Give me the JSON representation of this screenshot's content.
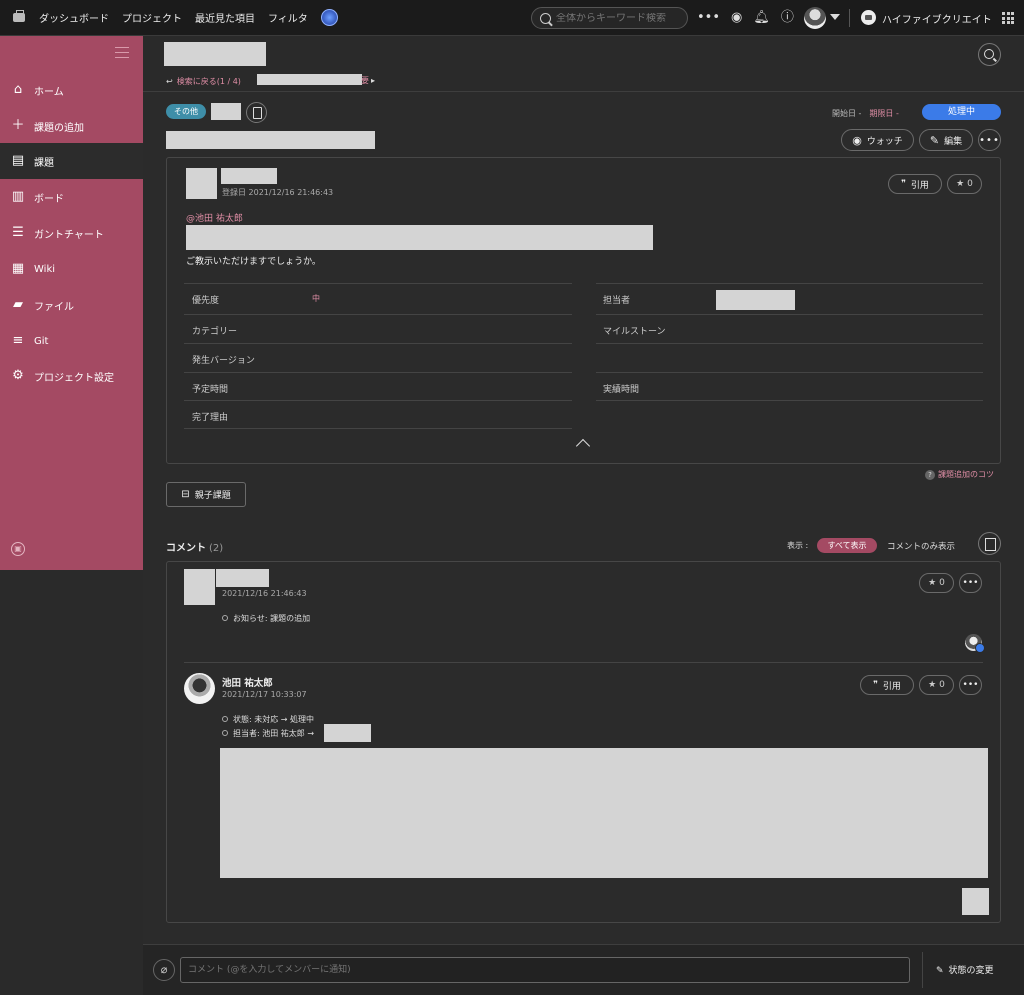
{
  "topbar": {
    "nav": [
      "ダッシュボード",
      "プロジェクト",
      "最近見た項目",
      "フィルタ"
    ],
    "search_placeholder": "全体からキーワード検索",
    "space_name": "ハイファイブクリエイト"
  },
  "sidebar": {
    "items": [
      {
        "label": "ホーム",
        "icon": "home-icon"
      },
      {
        "label": "課題の追加",
        "icon": "plus-icon"
      },
      {
        "label": "課題",
        "icon": "list-icon"
      },
      {
        "label": "ボード",
        "icon": "board-icon"
      },
      {
        "label": "ガントチャート",
        "icon": "gantt-icon"
      },
      {
        "label": "Wiki",
        "icon": "wiki-icon"
      },
      {
        "label": "ファイル",
        "icon": "folder-icon"
      },
      {
        "label": "Git",
        "icon": "git-icon"
      },
      {
        "label": "プロジェクト設定",
        "icon": "gear-icon"
      }
    ],
    "active_index": 2
  },
  "issue": {
    "back_link": "検索に戻る(1 / 4)",
    "crumb_tail": "要",
    "type_tag": "その他",
    "start_date_label": "開始日 -",
    "due_date_label": "期限日 -",
    "status": "処理中",
    "watch_label": "ウォッチ",
    "edit_label": "編集",
    "registered": "登録日  2021/12/16 21:46:43",
    "quote_label": "引用",
    "star_count": "0",
    "mention": "@池田 祐太郎",
    "description": "ご教示いただけますでしょうか。",
    "attributes_left": [
      {
        "key": "優先度",
        "value": "中"
      },
      {
        "key": "カテゴリー",
        "value": ""
      },
      {
        "key": "発生バージョン",
        "value": ""
      },
      {
        "key": "予定時間",
        "value": ""
      },
      {
        "key": "完了理由",
        "value": ""
      }
    ],
    "attributes_right": [
      {
        "key": "担当者",
        "value": ""
      },
      {
        "key": "マイルストーン",
        "value": ""
      },
      {
        "key": "",
        "value": ""
      },
      {
        "key": "実績時間",
        "value": ""
      }
    ],
    "tips": "課題追加のコツ",
    "parent_child": "親子課題"
  },
  "comments": {
    "title": "コメント",
    "count": "(2)",
    "show_label": "表示 :",
    "show_all": "すべて表示",
    "show_comments_only": "コメントのみ表示",
    "items": [
      {
        "date": "2021/12/16 21:46:43",
        "notes": [
          "お知らせ: 課題の追加"
        ],
        "star_count": "0"
      },
      {
        "author": "池田 祐太郎",
        "date": "2021/12/17 10:33:07",
        "notes": [
          "状態: 未対応 → 処理中",
          "担当者: 池田 祐太郎 →"
        ],
        "quote_label": "引用",
        "star_count": "0"
      }
    ]
  },
  "footer": {
    "comment_placeholder": "コメント (@を入力してメンバーに通知)",
    "change_state": "状態の変更"
  }
}
